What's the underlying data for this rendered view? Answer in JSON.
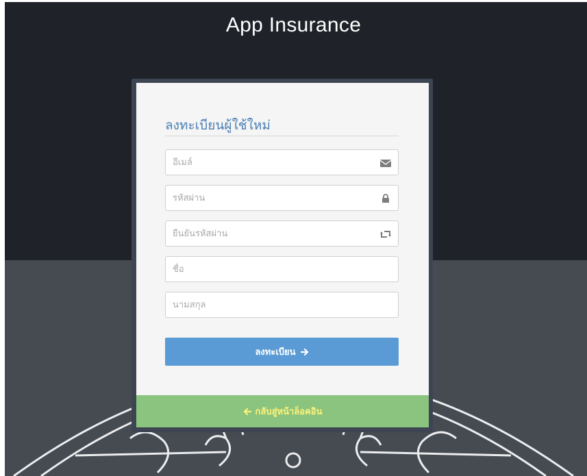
{
  "header": {
    "title": "App Insurance"
  },
  "form": {
    "title": "ลงทะเบียนผู้ใช้ใหม่",
    "email_placeholder": "อีเมล์",
    "password_placeholder": "รหัสผ่าน",
    "confirm_password_placeholder": "ยืนยันรหัสผ่าน",
    "first_name_placeholder": "ชื่อ",
    "last_name_placeholder": "นามสกุล",
    "submit_label": "ลงทะเบียน",
    "back_label": "กลับสู่หน้าล็อคอิน"
  },
  "icons": {
    "email": "envelope-icon",
    "password": "lock-icon",
    "confirm_password": "retweet-icon",
    "submit_arrow": "arrow-right-icon",
    "back_arrow": "arrow-left-icon"
  },
  "colors": {
    "header_bg": "#1f2329",
    "lower_bg": "#464a51",
    "card_bg": "#f5f5f5",
    "title_color": "#4a7fb5",
    "submit_bg": "#5b9bd5",
    "back_bg": "#8bc47e",
    "back_text": "#fff27a"
  }
}
